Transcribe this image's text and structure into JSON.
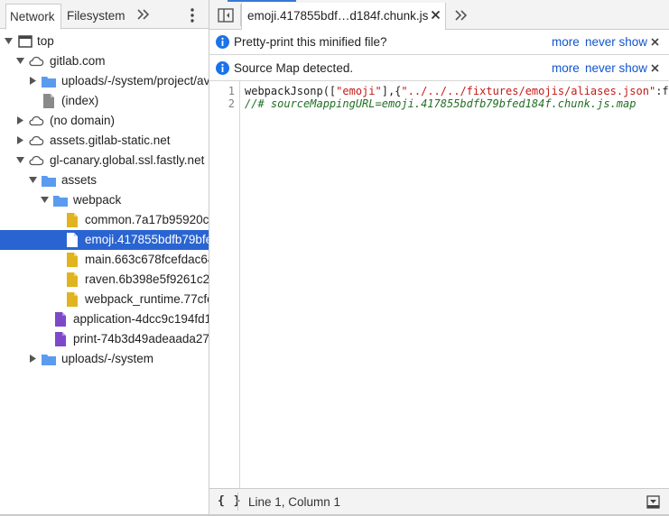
{
  "navigator": {
    "tabs": [
      {
        "label": "Network",
        "active": true
      },
      {
        "label": "Filesystem",
        "active": false
      }
    ],
    "more_tabs_icon": "double-chevron-right-icon",
    "menu_icon": "vertical-ellipsis-icon",
    "tree": [
      {
        "label": "top",
        "expanded": true,
        "type": "frame",
        "depth": 0
      },
      {
        "label": "gitlab.com",
        "expanded": true,
        "type": "domain",
        "depth": 1
      },
      {
        "label": "uploads/-/system/project/av",
        "expanded": false,
        "type": "folder",
        "depth": 2
      },
      {
        "label": "(index)",
        "type": "file-document",
        "depth": 2
      },
      {
        "label": "(no domain)",
        "expanded": false,
        "type": "domain",
        "depth": 1
      },
      {
        "label": "assets.gitlab-static.net",
        "expanded": false,
        "type": "domain",
        "depth": 1
      },
      {
        "label": "gl-canary.global.ssl.fastly.net",
        "expanded": true,
        "type": "domain",
        "depth": 1
      },
      {
        "label": "assets",
        "expanded": true,
        "type": "folder",
        "depth": 2
      },
      {
        "label": "webpack",
        "expanded": true,
        "type": "folder",
        "depth": 3
      },
      {
        "label": "common.7a17b95920c",
        "type": "file-script",
        "depth": 4
      },
      {
        "label": "emoji.417855bdfb79bfe",
        "type": "file-script",
        "depth": 4,
        "selected": true
      },
      {
        "label": "main.663c678fcefdac64",
        "type": "file-script",
        "depth": 4
      },
      {
        "label": "raven.6b398e5f9261c2c",
        "type": "file-script",
        "depth": 4
      },
      {
        "label": "webpack_runtime.77cfe",
        "type": "file-script",
        "depth": 4
      },
      {
        "label": "application-4dcc9c194fd1",
        "type": "file-stylesheet",
        "depth": 3
      },
      {
        "label": "print-74b3d49adeaada27",
        "type": "file-stylesheet",
        "depth": 3
      },
      {
        "label": "uploads/-/system",
        "expanded": false,
        "type": "folder",
        "depth": 2
      }
    ]
  },
  "editor": {
    "toggle_navigator_icon": "toggle-sidebar-icon",
    "open_tab": {
      "title": "emoji.417855bdf…d184f.chunk.js",
      "close_icon": "close-icon"
    },
    "more_tabs_icon": "double-chevron-right-icon",
    "infobars": [
      {
        "text": "Pretty-print this minified file?",
        "more": "more",
        "never_show": "never show",
        "icon": "info-icon"
      },
      {
        "text": "Source Map detected.",
        "more": "more",
        "never_show": "never show",
        "icon": "info-icon"
      }
    ],
    "line_numbers": [
      "1",
      "2"
    ],
    "code": {
      "line1_prefix": "webpackJsonp([",
      "line1_str1": "\"emoji\"",
      "line1_mid": "],{",
      "line1_str2": "\"../../../fixtures/emojis/aliases.json\"",
      "line1_suffix": ":f",
      "line2_comment": "//# sourceMappingURL=emoji.417855bdfb79bfed184f.chunk.js.map"
    },
    "status": {
      "pretty_print_label": "{ }",
      "cursor_position": "Line 1, Column 1",
      "coverage_icon": "drawer-toggle-icon"
    }
  },
  "colors": {
    "selection": "#2a64d1",
    "link": "#1155cc",
    "info_icon": "#1a73e8",
    "folder": "#5a9bf0",
    "script_file": "#e0b41e",
    "stylesheet_file": "#7e49c9",
    "code_string": "#c41a16",
    "code_comment": "#236e25"
  }
}
